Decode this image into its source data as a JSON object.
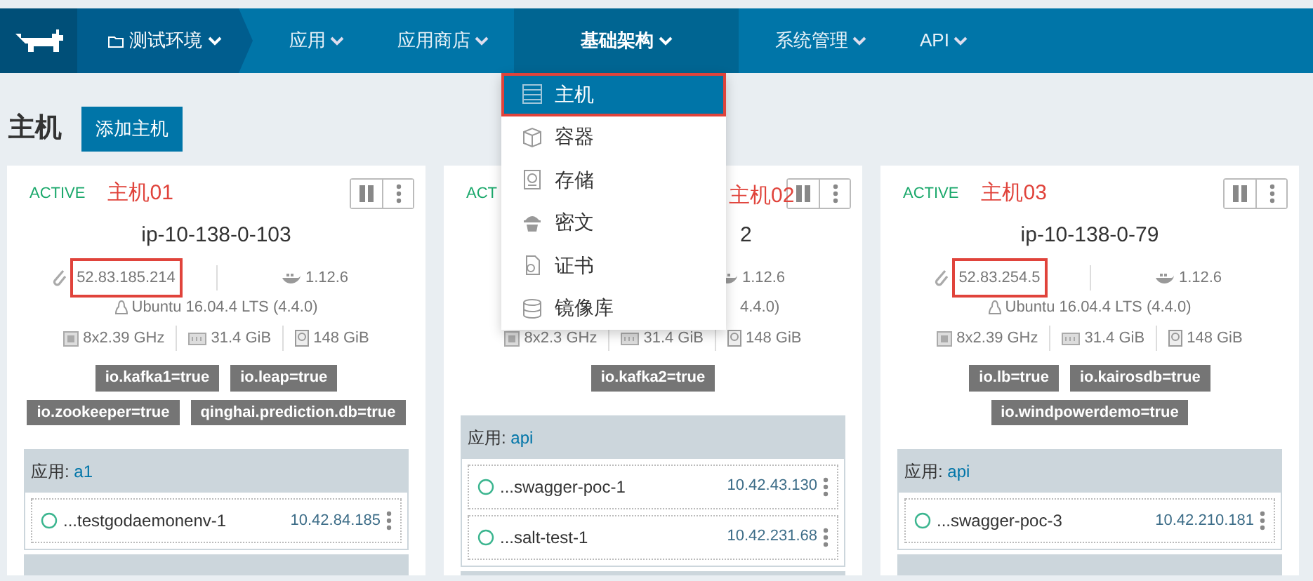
{
  "nav": {
    "environment": "测试环境",
    "items": [
      {
        "label": "应用",
        "selected": false
      },
      {
        "label": "应用商店",
        "selected": false
      },
      {
        "label": "基础架构",
        "selected": true
      },
      {
        "label": "系统管理",
        "selected": false
      },
      {
        "label": "API",
        "selected": false
      }
    ]
  },
  "menu": [
    {
      "label": "主机",
      "kind": "host",
      "selected": true,
      "highlighted": true
    },
    {
      "label": "容器",
      "kind": "container",
      "selected": false,
      "highlighted": false
    },
    {
      "label": "存储",
      "kind": "storage",
      "selected": false,
      "highlighted": false
    },
    {
      "label": "密文",
      "kind": "secret",
      "selected": false,
      "highlighted": false
    },
    {
      "label": "证书",
      "kind": "certificate",
      "selected": false,
      "highlighted": false
    },
    {
      "label": "镜像库",
      "kind": "registry",
      "selected": false,
      "highlighted": false
    }
  ],
  "page": {
    "title": "主机",
    "add_button": "添加主机"
  },
  "hosts": [
    {
      "covered": false,
      "status": "ACTIVE",
      "note": "主机01",
      "hostname": "ip-10-138-0-103",
      "ip": "52.83.185.214",
      "ip_highlighted": true,
      "docker": "1.12.6",
      "os": "Ubuntu 16.04.4 LTS (4.4.0)",
      "cpu": "8x2.39 GHz",
      "memory": "31.4 GiB",
      "disk": "148 GiB",
      "labels": [
        "io.kafka1=true",
        "io.leap=true",
        "io.zookeeper=true",
        "qinghai.prediction.db=true"
      ],
      "stack": {
        "prefix": "应用:",
        "name": "a1"
      },
      "containers": [
        {
          "name": "...testgodaemonenv-1",
          "ip": "10.42.84.185"
        }
      ]
    },
    {
      "covered": true,
      "status": "ACT",
      "note": "主机02",
      "hostname": "2",
      "docker": "1.12.6",
      "os": "4.4.0)",
      "cpu": "8x2.3 GHz",
      "memory": "31.4 GiB",
      "disk": "148 GiB",
      "labels": [
        "io.kafka2=true"
      ],
      "stack": {
        "prefix": "应用:",
        "name": "api"
      },
      "containers": [
        {
          "name": "...swagger-poc-1",
          "ip": "10.42.43.130"
        },
        {
          "name": "...salt-test-1",
          "ip": "10.42.231.68"
        }
      ]
    },
    {
      "covered": false,
      "status": "ACTIVE",
      "note": "主机03",
      "hostname": "ip-10-138-0-79",
      "ip": "52.83.254.5",
      "ip_highlighted": true,
      "docker": "1.12.6",
      "os": "Ubuntu 16.04.4 LTS (4.4.0)",
      "cpu": "8x2.39 GHz",
      "memory": "31.4 GiB",
      "disk": "148 GiB",
      "labels": [
        "io.lb=true",
        "io.kairosdb=true",
        "io.windpowerdemo=true"
      ],
      "stack": {
        "prefix": "应用:",
        "name": "api"
      },
      "containers": [
        {
          "name": "...swagger-poc-3",
          "ip": "10.42.210.181"
        }
      ]
    }
  ]
}
